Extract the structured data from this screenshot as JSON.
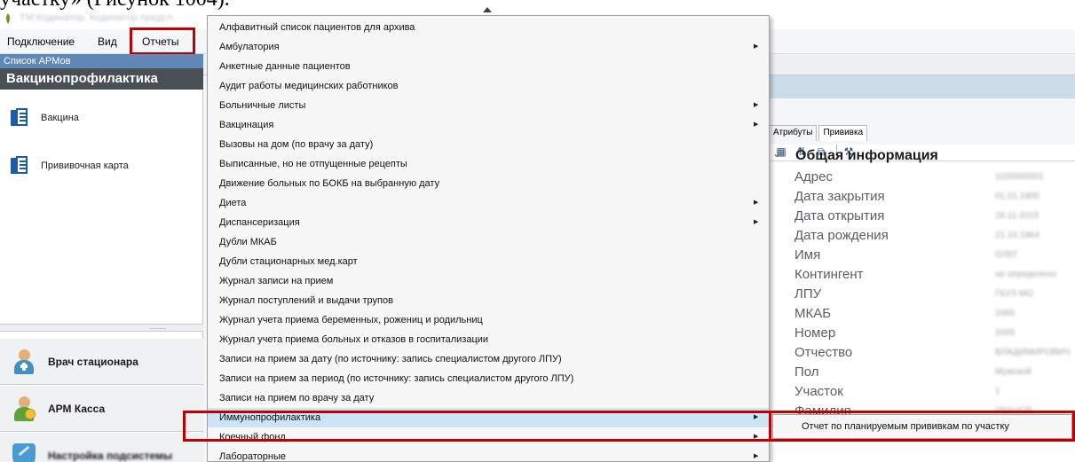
{
  "document": {
    "caption": "участку» (Рисунок 1004)."
  },
  "window": {
    "title": "ТМ:Кодинатор, Кодинатор предсл."
  },
  "menubar": {
    "items": [
      "Подключение",
      "Вид",
      "Отчеты"
    ]
  },
  "sidebar": {
    "crumb": "Список АРМов",
    "header": "Вакцинопрофилактика",
    "items": [
      {
        "label": "Вакцина",
        "icon": "book-icon"
      },
      {
        "label": "Прививочная карта",
        "icon": "book-icon"
      }
    ],
    "splitter_dots": "..........",
    "nav": [
      {
        "label": "Врач стационара",
        "icon": "doctor-icon"
      },
      {
        "label": "АРМ Касса",
        "icon": "cashier-icon"
      },
      {
        "label": "Настройка подсистемы",
        "icon": "settings-shield-icon"
      }
    ]
  },
  "context_menu": {
    "items": [
      {
        "label": "Алфавитный список пациентов для архива",
        "submenu": false
      },
      {
        "label": "Амбулатория",
        "submenu": true
      },
      {
        "label": "Анкетные данные пациентов",
        "submenu": false
      },
      {
        "label": "Аудит работы медицинских работников",
        "submenu": false
      },
      {
        "label": "Больничные листы",
        "submenu": true
      },
      {
        "label": "Вакцинация",
        "submenu": true
      },
      {
        "label": "Вызовы на дом (по врачу за дату)",
        "submenu": false
      },
      {
        "label": "Выписанные, но не отпущенные рецепты",
        "submenu": false
      },
      {
        "label": "Движение больных по БОКБ на выбранную дату",
        "submenu": false
      },
      {
        "label": "Диета",
        "submenu": true
      },
      {
        "label": "Диспансеризация",
        "submenu": true
      },
      {
        "label": "Дубли МКАБ",
        "submenu": false
      },
      {
        "label": "Дубли стационарных мед.карт",
        "submenu": false
      },
      {
        "label": "Журнал записи на прием",
        "submenu": false
      },
      {
        "label": "Журнал поступлений и выдачи трупов",
        "submenu": false
      },
      {
        "label": "Журнал учета приема беременных, рожениц и родильниц",
        "submenu": false
      },
      {
        "label": "Журнал учета приема больных и отказов в госпитализации",
        "submenu": false
      },
      {
        "label": "Записи на прием за дату (по источнику: запись специалистом другого ЛПУ)",
        "submenu": false
      },
      {
        "label": "Записи на прием за период (по источнику: запись специалистом другого ЛПУ)",
        "submenu": false
      },
      {
        "label": "Записи на прием по врачу за дату",
        "submenu": false
      },
      {
        "label": "Иммунопрофилактика",
        "submenu": true,
        "highlighted": true
      },
      {
        "label": "Коечный фонд",
        "submenu": true
      },
      {
        "label": "Лабораторные",
        "submenu": true
      }
    ]
  },
  "submenu": {
    "items": [
      "Отчет по планируемым прививкам по участку"
    ]
  },
  "properties": {
    "tabs": [
      "Атрибуты",
      "Прививка"
    ],
    "toolbar": [
      "categorized-icon",
      "sort-az-icon",
      "pages-icon",
      "settings-icon"
    ],
    "category": "Общая информация",
    "rows": [
      {
        "label": "Адрес",
        "value": "1100000001"
      },
      {
        "label": "Дата закрытия",
        "value": "01.01.1900"
      },
      {
        "label": "Дата открытия",
        "value": "16.11.2015"
      },
      {
        "label": "Дата рождения",
        "value": "21.10.1964"
      },
      {
        "label": "Имя",
        "value": "ОЛЕГ"
      },
      {
        "label": "Контингент",
        "value": "не определено"
      },
      {
        "label": "ЛПУ",
        "value": "ГБУЗ МО"
      },
      {
        "label": "МКАБ",
        "value": "2465"
      },
      {
        "label": "Номер",
        "value": "2465"
      },
      {
        "label": "Отчество",
        "value": "ВЛАДИМИРОВИЧ"
      },
      {
        "label": "Пол",
        "value": "Мужской"
      },
      {
        "label": "Участок",
        "value": "1"
      },
      {
        "label": "Фамилия",
        "value": "ИВАНОВ"
      }
    ]
  },
  "colors": {
    "highlight_box": "#c00000",
    "selection": "#cce4f7",
    "sidebar_header": "#494f55"
  }
}
